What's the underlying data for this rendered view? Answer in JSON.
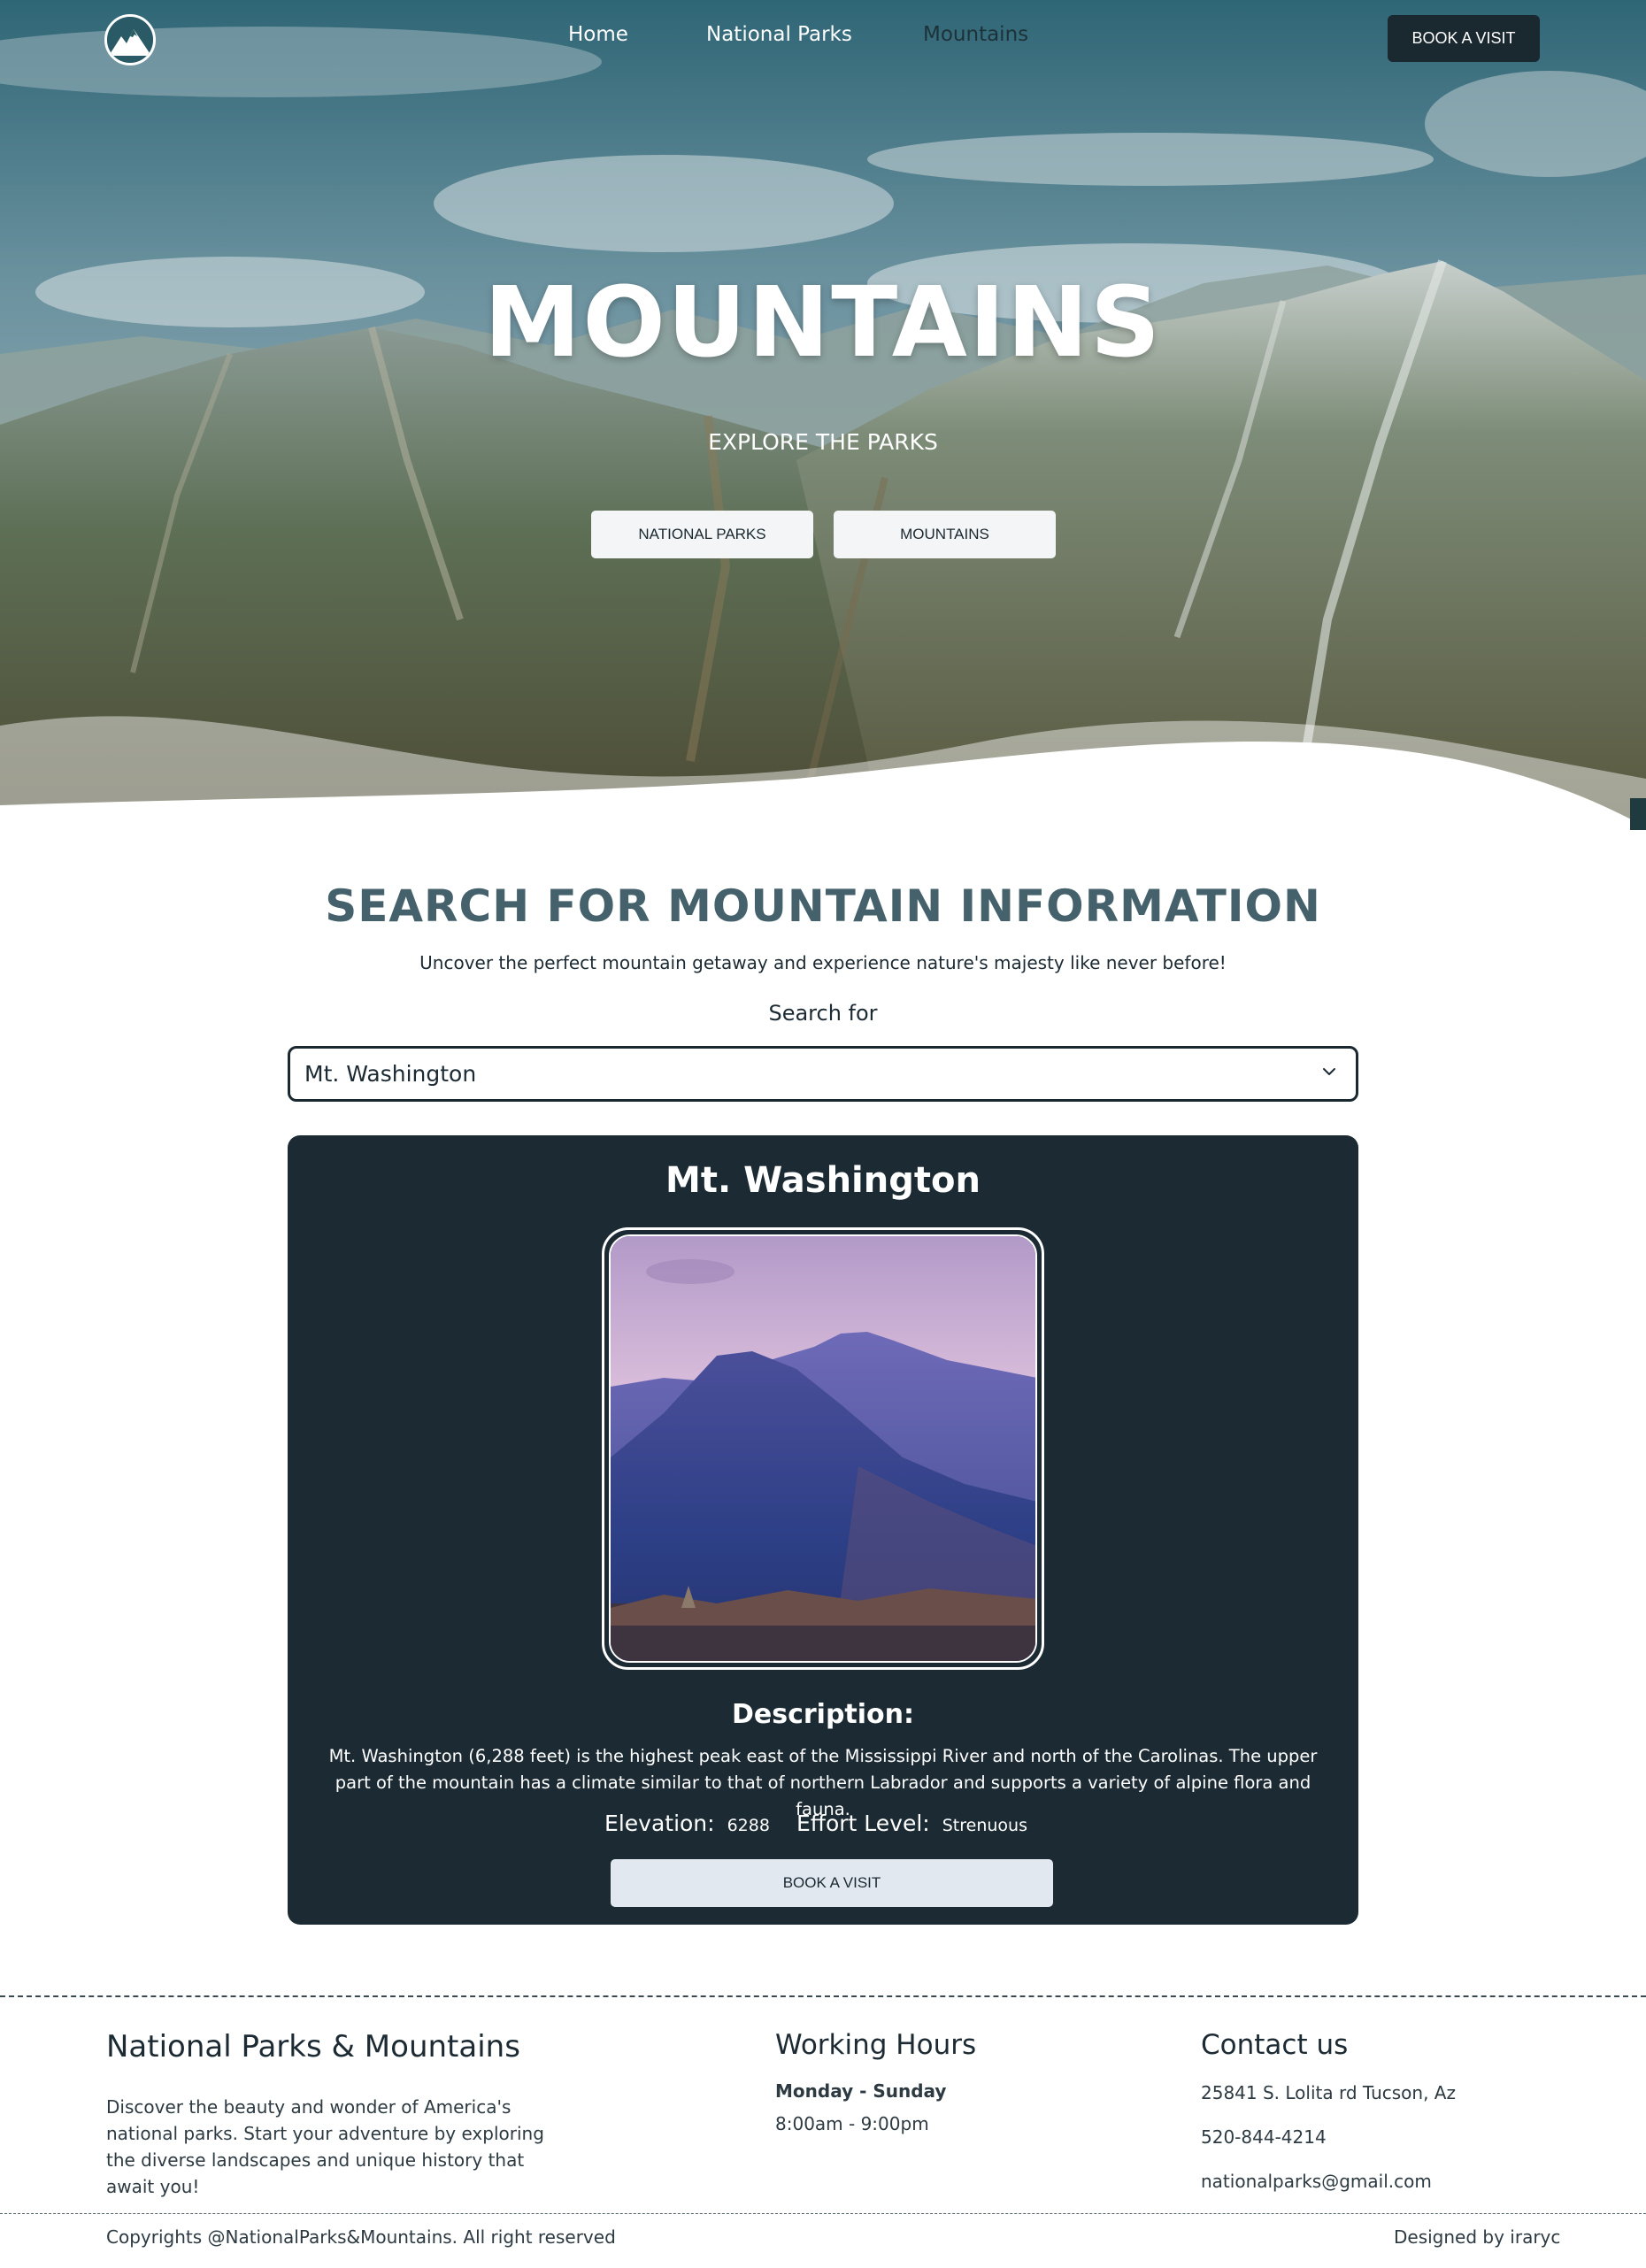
{
  "nav": {
    "logo_icon": "mountain-logo-icon",
    "links": [
      {
        "label": "Home",
        "active": false
      },
      {
        "label": "National Parks",
        "active": false
      },
      {
        "label": "Mountains",
        "active": true
      }
    ],
    "cta_label": "BOOK A VISIT"
  },
  "hero": {
    "title": "MOUNTAINS",
    "subtitle": "EXPLORE THE PARKS",
    "buttons": [
      "NATIONAL PARKS",
      "MOUNTAINS"
    ]
  },
  "search": {
    "title": "SEARCH FOR MOUNTAIN INFORMATION",
    "description": "Uncover the perfect mountain getaway and experience nature's majesty like never before!",
    "label": "Search for",
    "selected": "Mt. Washington",
    "chevron_icon": "chevron-down-icon"
  },
  "result": {
    "name": "Mt. Washington",
    "description_heading": "Description:",
    "description": "Mt. Washington (6,288 feet) is the highest peak east of the Mississippi River and north of the Carolinas. The upper part of the mountain has a climate similar to that of northern Labrador and supports a variety of alpine flora and fauna.",
    "elevation_label": "Elevation:",
    "elevation_value": "6288",
    "effort_label": "Effort Level:",
    "effort_value": "Strenuous",
    "button_label": "BOOK A VISIT"
  },
  "footer": {
    "brand_title": "National Parks & Mountains",
    "brand_text": "Discover the beauty and wonder of America's national parks. Start your adventure by exploring the diverse landscapes and unique history that await you!",
    "hours_title": "Working Hours",
    "hours_days": "Monday - Sunday",
    "hours_time": "8:00am - 9:00pm",
    "contact_title": "Contact us",
    "address": "25841 S. Lolita rd Tucson, Az",
    "phone": "520-844-4214",
    "email": "nationalparks@gmail.com",
    "copyright": "Copyrights @NationalParks&Mountains. All right reserved",
    "designer": "Designed by iraryc"
  },
  "colors": {
    "dark": "#1b2a33",
    "heading": "#45616c",
    "light_button": "#e2e8f0"
  }
}
